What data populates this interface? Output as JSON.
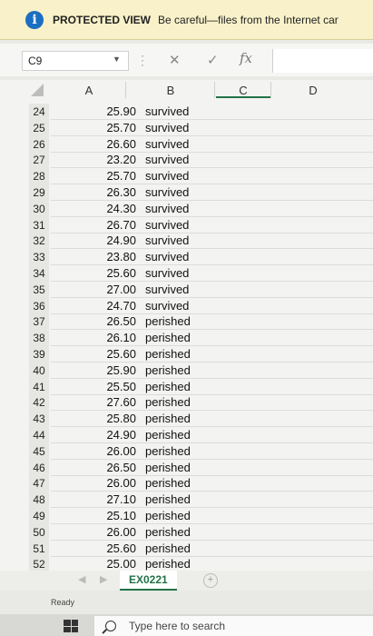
{
  "banner": {
    "label": "PROTECTED VIEW",
    "message": "Be careful—files from the Internet car"
  },
  "formula_bar": {
    "name_box": "C9",
    "fx": "fx"
  },
  "columns": [
    "A",
    "B",
    "C",
    "D"
  ],
  "rows": [
    {
      "num": "24",
      "a": "25.90",
      "b": "survived"
    },
    {
      "num": "25",
      "a": "25.70",
      "b": "survived"
    },
    {
      "num": "26",
      "a": "26.60",
      "b": "survived"
    },
    {
      "num": "27",
      "a": "23.20",
      "b": "survived"
    },
    {
      "num": "28",
      "a": "25.70",
      "b": "survived"
    },
    {
      "num": "29",
      "a": "26.30",
      "b": "survived"
    },
    {
      "num": "30",
      "a": "24.30",
      "b": "survived"
    },
    {
      "num": "31",
      "a": "26.70",
      "b": "survived"
    },
    {
      "num": "32",
      "a": "24.90",
      "b": "survived"
    },
    {
      "num": "33",
      "a": "23.80",
      "b": "survived"
    },
    {
      "num": "34",
      "a": "25.60",
      "b": "survived"
    },
    {
      "num": "35",
      "a": "27.00",
      "b": "survived"
    },
    {
      "num": "36",
      "a": "24.70",
      "b": "survived"
    },
    {
      "num": "37",
      "a": "26.50",
      "b": "perished"
    },
    {
      "num": "38",
      "a": "26.10",
      "b": "perished"
    },
    {
      "num": "39",
      "a": "25.60",
      "b": "perished"
    },
    {
      "num": "40",
      "a": "25.90",
      "b": "perished"
    },
    {
      "num": "41",
      "a": "25.50",
      "b": "perished"
    },
    {
      "num": "42",
      "a": "27.60",
      "b": "perished"
    },
    {
      "num": "43",
      "a": "25.80",
      "b": "perished"
    },
    {
      "num": "44",
      "a": "24.90",
      "b": "perished"
    },
    {
      "num": "45",
      "a": "26.00",
      "b": "perished"
    },
    {
      "num": "46",
      "a": "26.50",
      "b": "perished"
    },
    {
      "num": "47",
      "a": "26.00",
      "b": "perished"
    },
    {
      "num": "48",
      "a": "27.10",
      "b": "perished"
    },
    {
      "num": "49",
      "a": "25.10",
      "b": "perished"
    },
    {
      "num": "50",
      "a": "26.00",
      "b": "perished"
    },
    {
      "num": "51",
      "a": "25.60",
      "b": "perished"
    },
    {
      "num": "52",
      "a": "25.00",
      "b": "perished"
    }
  ],
  "sheet_tab": "EX0221",
  "status": "Ready",
  "taskbar": {
    "search_placeholder": "Type here to search"
  },
  "colors": {
    "accent": "#217346",
    "banner_bg": "#f8f1c9",
    "info_icon": "#1b6fc2"
  }
}
